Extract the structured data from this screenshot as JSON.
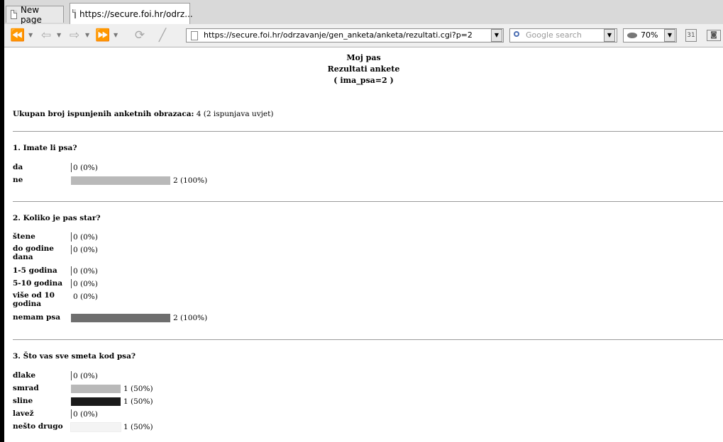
{
  "browser": {
    "tabs": [
      {
        "label": "New page"
      },
      {
        "label": "https://secure.foi.hr/odrz..."
      }
    ],
    "url": "https://secure.foi.hr/odrzavanje/gen_anketa/anketa/rezultati.cgi?p=2",
    "search_placeholder": "Google search",
    "zoom": "70%"
  },
  "page": {
    "title": "Moj pas",
    "subtitle": "Rezultati ankete",
    "filter": "( ima_psa=2 )",
    "summary_label": "Ukupan broj ispunjenih anketnih obrazaca:",
    "summary_value": "4 (2 ispunjava uvjet)"
  },
  "questions": [
    {
      "title": "1. Imate li psa?",
      "answers": [
        {
          "label": "da",
          "text": "0 (0%)",
          "fraction": 0,
          "color": ""
        },
        {
          "label": "ne",
          "text": "2 (100%)",
          "fraction": 1.0,
          "color": "#b9b9b9"
        }
      ]
    },
    {
      "title": "2. Koliko je pas star?",
      "answers": [
        {
          "label": "štene",
          "text": "0 (0%)",
          "fraction": 0,
          "color": ""
        },
        {
          "label": "do godine dana",
          "text": "0 (0%)",
          "fraction": 0,
          "color": ""
        },
        {
          "label": "1-5 godina",
          "text": "0 (0%)",
          "fraction": 0,
          "color": ""
        },
        {
          "label": "5-10 godina",
          "text": "0 (0%)",
          "fraction": 0,
          "color": ""
        },
        {
          "label": "više od 10 godina",
          "text": "0 (0%)",
          "fraction": 0,
          "color": ""
        },
        {
          "label": "nemam psa",
          "text": "2 (100%)",
          "fraction": 1.0,
          "color": "#6e6e6e"
        }
      ]
    },
    {
      "title": "3. Što vas sve smeta kod psa?",
      "answers": [
        {
          "label": "dlake",
          "text": "0 (0%)",
          "fraction": 0,
          "color": ""
        },
        {
          "label": "smrad",
          "text": "1 (50%)",
          "fraction": 0.5,
          "color": "#b9b9b9"
        },
        {
          "label": "sline",
          "text": "1 (50%)",
          "fraction": 0.5,
          "color": "#1a1a1a"
        },
        {
          "label": "lavež",
          "text": "0 (0%)",
          "fraction": 0,
          "color": ""
        },
        {
          "label": "nešto drugo",
          "text": "1 (50%)",
          "fraction": 0.5,
          "color": "#f4f4f4"
        }
      ]
    }
  ]
}
